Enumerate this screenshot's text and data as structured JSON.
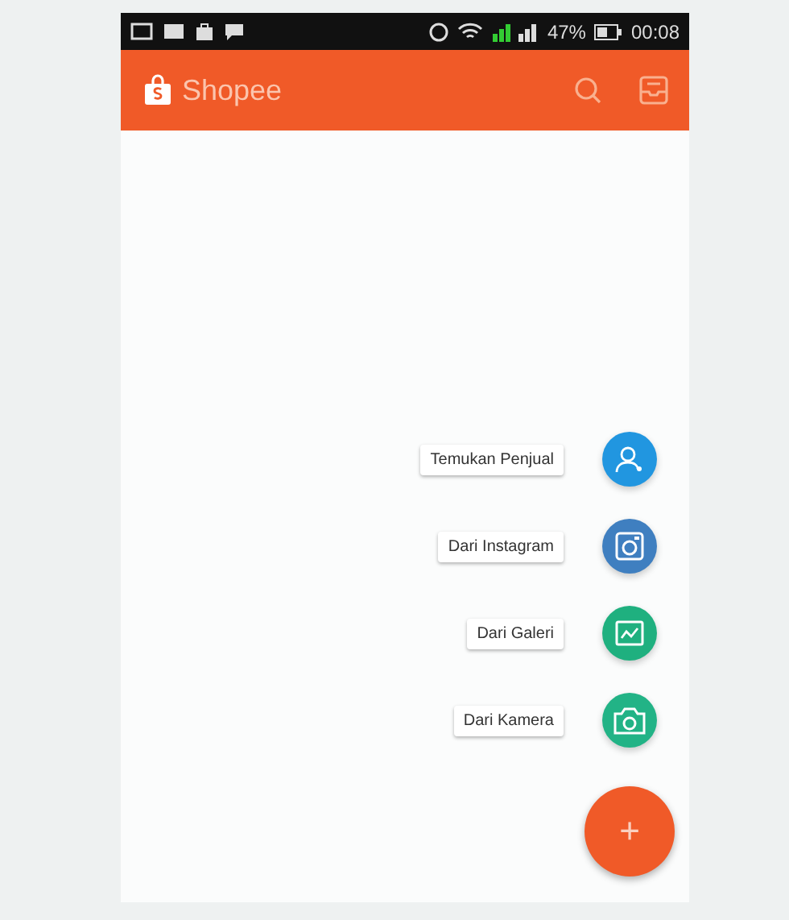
{
  "status_bar": {
    "battery": "47%",
    "time": "00:08"
  },
  "app_bar": {
    "title": "Shopee"
  },
  "fab_actions": [
    {
      "label": "Temukan Penjual",
      "color": "#2196e0"
    },
    {
      "label": "Dari Instagram",
      "color": "#3f7fc0"
    },
    {
      "label": "Dari Galeri",
      "color": "#1fb07f"
    },
    {
      "label": "Dari Kamera",
      "color": "#22b386"
    }
  ],
  "fab": {
    "label": "+"
  }
}
